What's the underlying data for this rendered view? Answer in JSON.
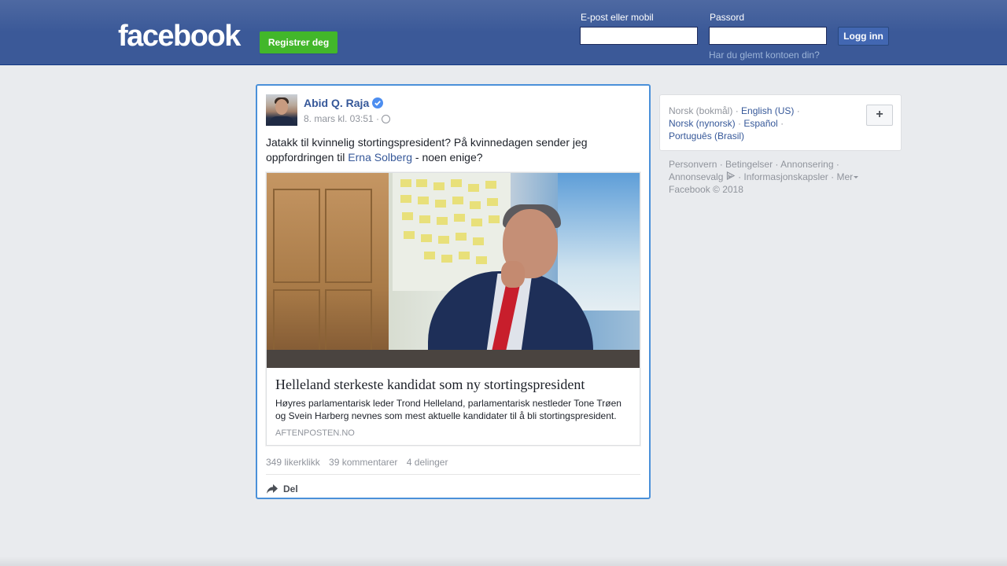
{
  "header": {
    "logo": "facebook",
    "register_label": "Registrer deg",
    "email_label": "E-post eller mobil",
    "password_label": "Passord",
    "login_label": "Logg inn",
    "forgot_label": "Har du glemt kontoen din?",
    "email_value": "",
    "password_value": ""
  },
  "post": {
    "author": "Abid Q. Raja",
    "verified": true,
    "date": "8. mars kl. 03:51 ·",
    "text_before": "Jatakk til kvinnelig stortingspresident? På kvinnedagen sender jeg oppfordringen til ",
    "mention": "Erna Solberg",
    "text_after": " - noen enige?",
    "preview": {
      "title": "Helleland sterkeste kandidat som ny stortingspresident",
      "description": "Høyres parlamentarisk leder Trond Helleland, parlamentarisk nestleder Tone Trøen og Svein Harberg nevnes som mest aktuelle kandidater til å bli stortingspresident.",
      "domain": "AFTENPOSTEN.NO"
    },
    "stats": {
      "likes": "349 likerklikk",
      "comments": "39 kommentarer",
      "shares": "4 delinger"
    },
    "share_label": "Del"
  },
  "languages": {
    "current": "Norsk (bokmål)",
    "options": [
      "English (US)",
      "Norsk (nynorsk)",
      "Español",
      "Português (Brasil)"
    ],
    "add_label": "+"
  },
  "footer": {
    "links": [
      "Personvern",
      "Betingelser",
      "Annonsering",
      "Annonsevalg",
      "Informasjonskapsler",
      "Mer"
    ],
    "copyright": "Facebook © 2018"
  },
  "colors": {
    "brand_blue": "#3b5998",
    "register_green": "#42b72a",
    "link_blue": "#365899",
    "verified_blue": "#4d8ef0"
  }
}
